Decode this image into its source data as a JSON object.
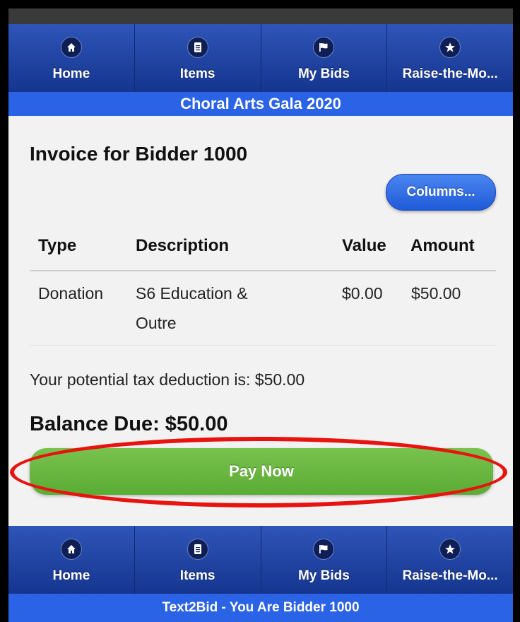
{
  "nav": {
    "items": [
      {
        "label": "Home",
        "icon": "home-icon"
      },
      {
        "label": "Items",
        "icon": "document-icon"
      },
      {
        "label": "My Bids",
        "icon": "flag-icon"
      },
      {
        "label": "Raise-the-Mo...",
        "icon": "star-icon"
      }
    ]
  },
  "event_banner": "Choral Arts Gala 2020",
  "invoice": {
    "title": "Invoice for Bidder 1000",
    "columns_button": "Columns...",
    "headers": [
      "Type",
      "Description",
      "Value",
      "Amount"
    ],
    "rows": [
      {
        "type": "Donation",
        "description_line1": "S6 Education &",
        "description_line2": "Outre",
        "value": "$0.00",
        "amount": "$50.00"
      }
    ],
    "tax_deduction_text": "Your potential tax deduction is: $50.00",
    "balance_due": "Balance Due: $50.00",
    "pay_button": "Pay Now"
  },
  "footer_banner": "Text2Bid - You Are Bidder 1000",
  "colors": {
    "nav_bg": "#1e3fa0",
    "banner_bg": "#2a63e6",
    "pay_button": "#67b83f",
    "highlight": "#e8120f"
  }
}
